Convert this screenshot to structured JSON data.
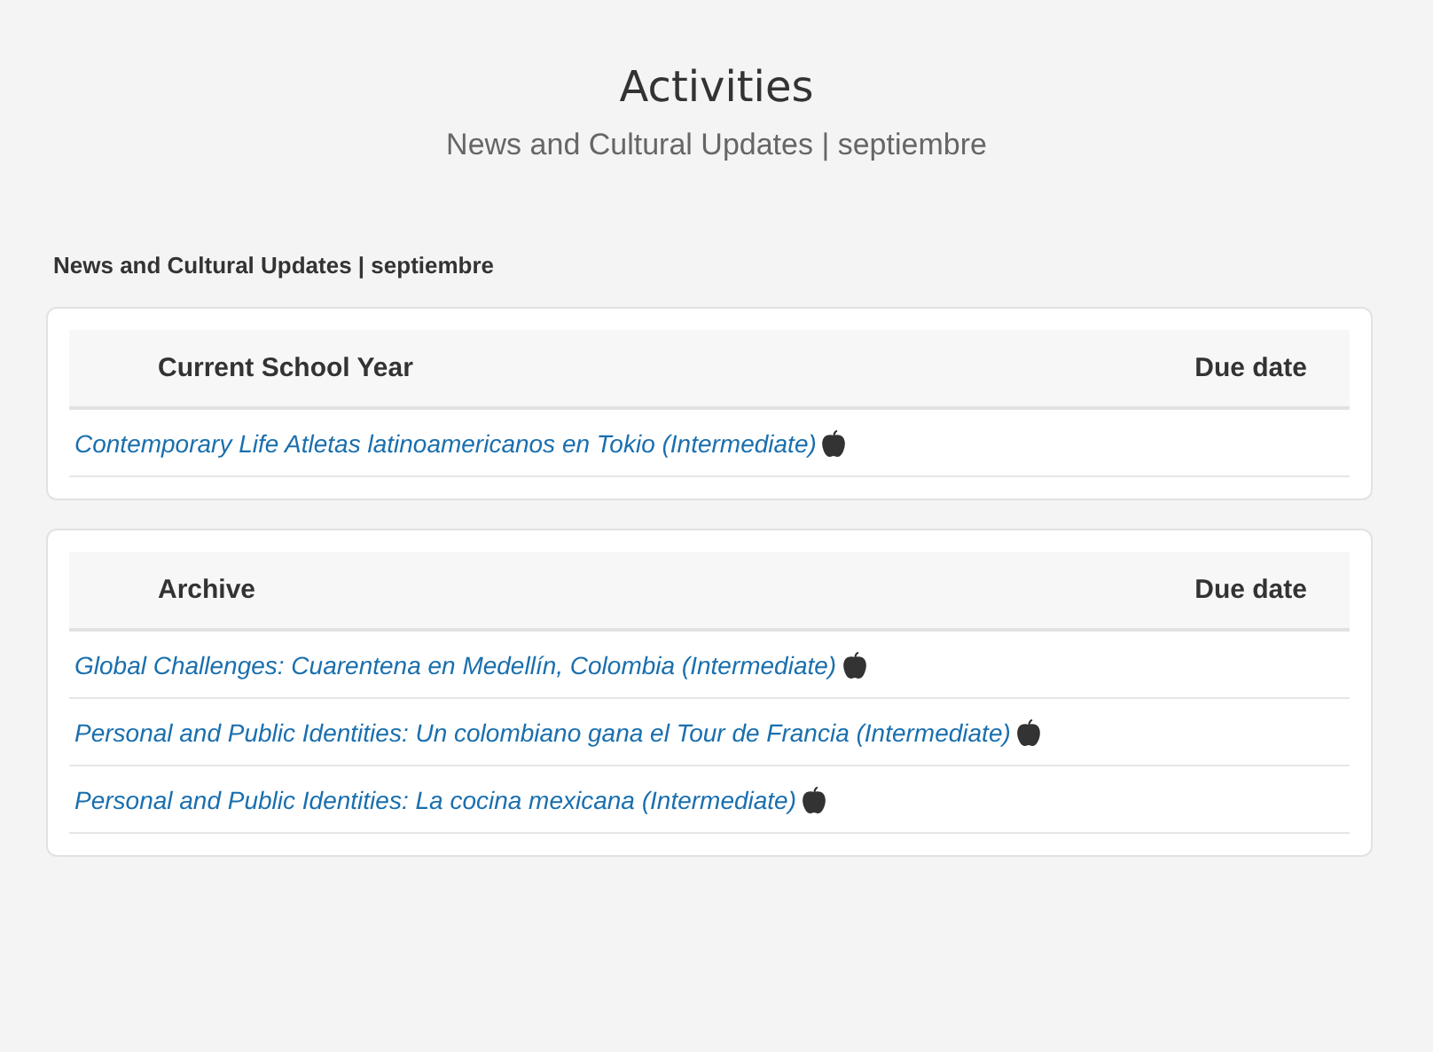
{
  "header": {
    "title": "Activities",
    "subtitle": "News and Cultural Updates | septiembre"
  },
  "section_title": "News and Cultural Updates | septiembre",
  "tables": [
    {
      "columns": [
        "Current School Year",
        "Due date"
      ],
      "rows": [
        {
          "title": "Contemporary Life Atletas latinoamericanos en Tokio (Intermediate)"
        }
      ]
    },
    {
      "columns": [
        "Archive",
        "Due date"
      ],
      "rows": [
        {
          "title": "Global Challenges: Cuarentena en Medellín, Colombia (Intermediate)"
        },
        {
          "title": "Personal and Public Identities: Un colombiano gana el Tour de Francia (Intermediate)"
        },
        {
          "title": "Personal and Public Identities: La cocina mexicana (Intermediate)"
        }
      ]
    }
  ]
}
